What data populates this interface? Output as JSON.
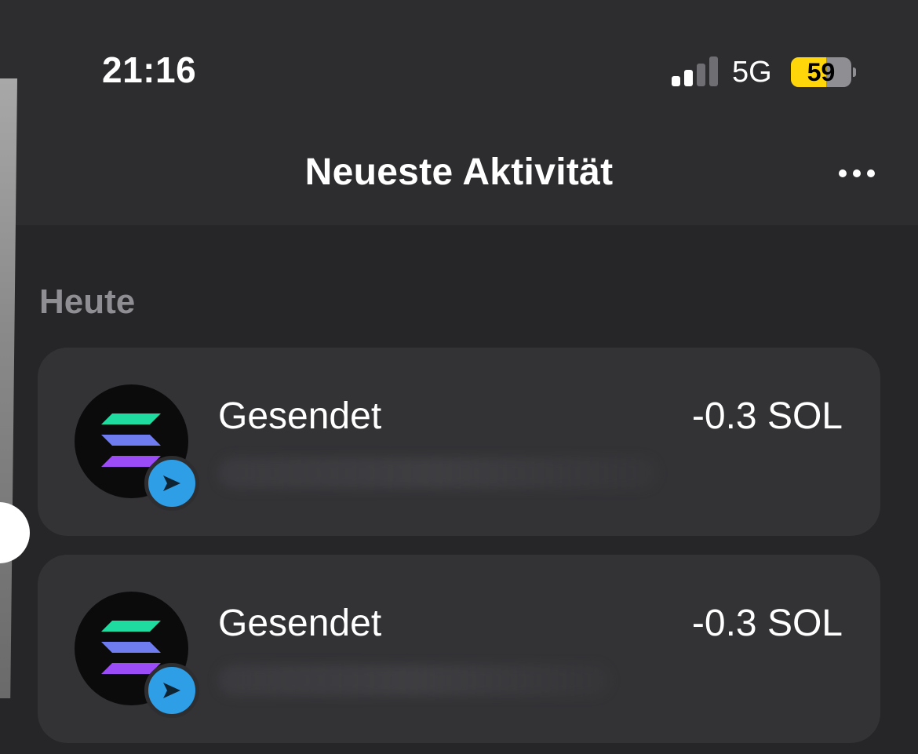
{
  "status_bar": {
    "time": "21:16",
    "signal_bars_active": 2,
    "signal_bars_total": 4,
    "network": "5G",
    "battery_level": "59",
    "battery_fraction": 0.59,
    "battery_color": "#ffd60a"
  },
  "nav": {
    "title": "Neueste Aktivität",
    "more_icon": "more-horizontal-icon"
  },
  "sections": [
    {
      "header": "Heute",
      "items": [
        {
          "title": "Gesendet",
          "amount": "-0.3 SOL",
          "token_icon": "solana-logo",
          "badge_icon": "send-arrow-icon"
        },
        {
          "title": "Gesendet",
          "amount": "-0.3 SOL",
          "token_icon": "solana-logo",
          "badge_icon": "send-arrow-icon"
        }
      ]
    }
  ],
  "colors": {
    "background": "#262628",
    "card": "#333336",
    "accent_blue": "#2e9fe6",
    "solana_gradient": [
      "#14f195",
      "#9945ff"
    ]
  }
}
